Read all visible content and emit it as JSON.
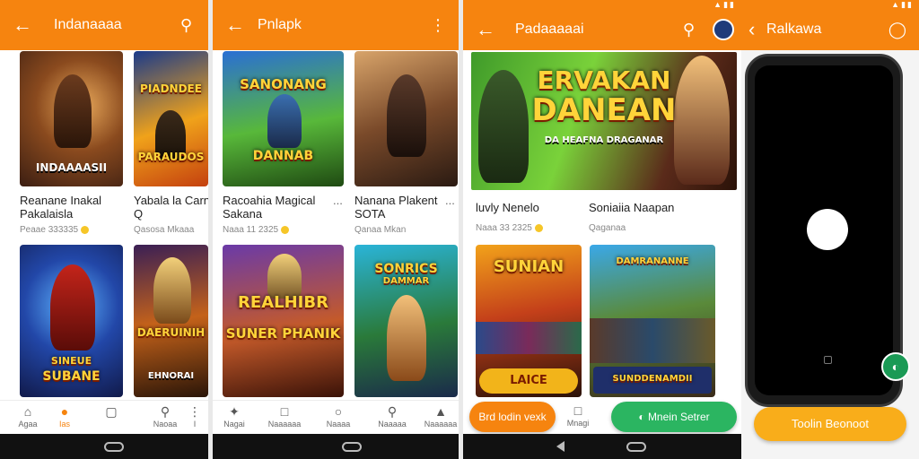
{
  "colors": {
    "accent": "#f6840f",
    "green": "#2bb561",
    "dark": "#111111"
  },
  "screens": [
    {
      "title": "Indanaaaa",
      "action_icons": [
        "back-arrow-icon",
        "search-icon"
      ],
      "cards": [
        {
          "art_text": "INDAAAASII",
          "title_line1": "Reanane Inakal",
          "title_line2": "Pakalaisla",
          "sub": "Peaae 333335",
          "has_badge": true,
          "more": ""
        },
        {
          "art_text": "PIADNDEE",
          "art_text2": "PARAUDOS",
          "title_line1": "Yabala la Carna",
          "title_line2": "Q",
          "sub": "Qasosa Mkaaa",
          "has_badge": false,
          "more": ""
        },
        {
          "art_text": "SINEUE",
          "art_text2": "SUBANE",
          "title_line1": "",
          "title_line2": "",
          "sub": "",
          "has_badge": false,
          "more": ""
        },
        {
          "art_text": "DAERUINIH",
          "art_text2": "EHNORAI",
          "title_line1": "",
          "title_line2": "",
          "sub": "",
          "has_badge": false,
          "more": ""
        }
      ],
      "nav": [
        {
          "icon": "home-icon",
          "label": "Agaa",
          "active": false
        },
        {
          "icon": "games-icon",
          "label": "Ias",
          "active": true
        },
        {
          "icon": "store-icon",
          "label": "",
          "active": false
        },
        {
          "icon": "search-icon",
          "label": "Naoaa",
          "active": false
        },
        {
          "icon": "more-icon",
          "label": "I",
          "active": false
        }
      ]
    },
    {
      "title": "Pnlapk",
      "cards": [
        {
          "art_text": "SANONANG",
          "art_text2": "DANNAB",
          "chips": [
            "",
            ""
          ],
          "title_line1": "Racoahia Magical",
          "title_line2": "Sakana",
          "sub": "Naaa 11 2325",
          "has_badge": true,
          "more": "..."
        },
        {
          "art_text": "",
          "chips": [
            "",
            ""
          ],
          "title_line1": "Nanana Plakent",
          "title_line2": "SOTA",
          "sub": "Qanaa Mkan",
          "has_badge": false,
          "more": "..."
        },
        {
          "art_text": "REALHIBR",
          "art_text2": "SUNER PHANIK",
          "title_line1": "",
          "title_line2": "",
          "sub": "",
          "has_badge": false,
          "more": ""
        },
        {
          "art_text": "SONRICS",
          "art_text2": "DAMMAR",
          "title_line1": "",
          "title_line2": "",
          "sub": "",
          "has_badge": false,
          "more": ""
        }
      ],
      "nav": [
        {
          "icon": "sparkle-icon",
          "label": "Nagai",
          "active": false
        },
        {
          "icon": "chat-icon",
          "label": "Naaaaaa",
          "active": false
        },
        {
          "icon": "store-icon",
          "label": "Naaaa",
          "active": false
        },
        {
          "icon": "search-icon",
          "label": "Naaaaa",
          "active": false
        },
        {
          "icon": "trophy-icon",
          "label": "Naaaaaa",
          "active": false
        }
      ]
    },
    {
      "title": "Padaaaaai",
      "banner_text1": "ERVAKAN",
      "banner_text2": "DANEAN",
      "banner_text3": "DA HEAFNA DRAGANAR",
      "left": {
        "title": "luvly Nenelo",
        "sub": "Naaa 33 2325",
        "has_badge": true
      },
      "right": {
        "title": "Soniaiia Naapan",
        "sub": "Qaganaa"
      },
      "card_left_text": "SUNIAN",
      "card_left_strip": "LAICE",
      "card_right_text": "DAMRANANNE",
      "card_right_strip": "SUNDDENAMDII",
      "pill_left": "Brd lodin vexk",
      "nav_label": "Mnagi",
      "pill_right": "Mnein Setrer"
    },
    {
      "title": "Ralkawa",
      "primary_button": "Toolin Beonoot"
    }
  ]
}
